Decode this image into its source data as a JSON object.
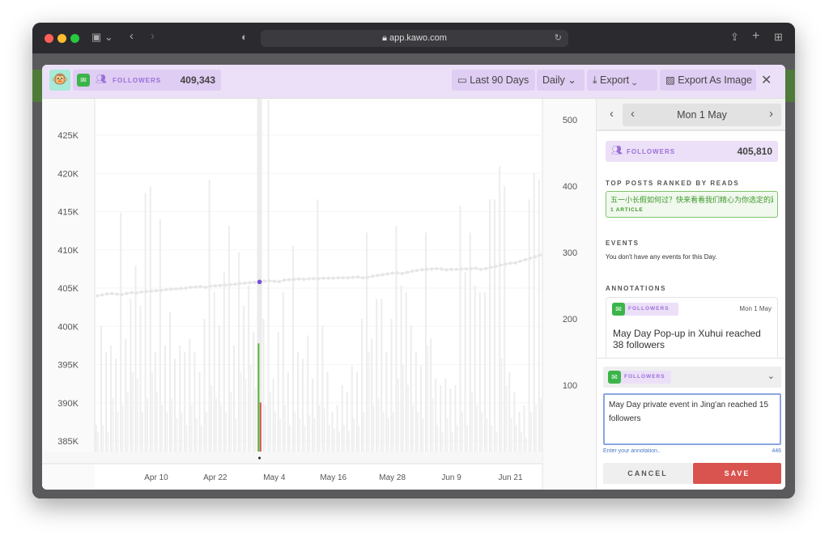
{
  "browser": {
    "url": "app.kawo.com"
  },
  "header": {
    "metric_label": "FOLLOWERS",
    "metric_value": "409,343",
    "range_label": "Last 90 Days",
    "interval_label": "Daily",
    "export_label": "Export",
    "export_image_label": "Export As Image"
  },
  "side": {
    "date": "Mon 1 May",
    "followers_label": "FOLLOWERS",
    "followers_value": "405,810",
    "top_posts_title": "TOP POSTS RANKED BY READS",
    "top_post_title": "五一小长假如何过？快来看看我们精心为你选定的路线",
    "top_post_count": "1 ARTICLE",
    "events_title": "EVENTS",
    "events_empty": "You don't have any events for this Day.",
    "annotations_title": "ANNOTATIONS",
    "annotation": {
      "metric": "FOLLOWERS",
      "date": "Mon 1 May",
      "text": "May Day Pop-up in Xuhui reached 38 followers"
    },
    "editor": {
      "metric": "FOLLOWERS",
      "value": "May Day private event in Jing'an reached 15 followers",
      "hint": "Enter your annotation..",
      "remaining": "446",
      "cancel": "CANCEL",
      "save": "SAVE"
    }
  },
  "colors": {
    "accent": "#9b6fd8",
    "green_bar": "#5bb33a",
    "red_bar": "#d9534f",
    "save": "#d9534f",
    "wechat": "#3bb54a"
  },
  "chart_data": {
    "type": "bar+line",
    "x_start": "2023-03-29",
    "x_end": "2023-06-27",
    "x_ticks": [
      "Apr 10",
      "Apr 22",
      "May 4",
      "May 16",
      "May 28",
      "Jun 9",
      "Jun 21"
    ],
    "x_tick_days": [
      12,
      24,
      36,
      48,
      60,
      72,
      84
    ],
    "left_axis": {
      "ticks": [
        "385K",
        "390K",
        "395K",
        "400K",
        "405K",
        "410K",
        "415K",
        "420K",
        "425K"
      ],
      "range": [
        381000,
        430000
      ]
    },
    "right_axis": {
      "ticks": [
        "100",
        "200",
        "300",
        "400",
        "500"
      ],
      "range": [
        0,
        530
      ]
    },
    "highlight_index": 33,
    "followers": [
      404000,
      404100,
      404250,
      404300,
      404200,
      404150,
      404300,
      404400,
      404350,
      404500,
      404550,
      404600,
      404650,
      404700,
      404800,
      404850,
      404900,
      404950,
      405000,
      405100,
      405150,
      405200,
      405100,
      405250,
      405300,
      405350,
      405400,
      405450,
      405500,
      405600,
      405650,
      405700,
      405750,
      405810,
      405900,
      405950,
      405900,
      405850,
      406050,
      406100,
      406150,
      406200,
      406150,
      406200,
      406250,
      406250,
      406300,
      406300,
      406300,
      406350,
      406350,
      406350,
      406400,
      406450,
      406350,
      406400,
      406550,
      406650,
      406750,
      406850,
      406950,
      407000,
      406900,
      407050,
      407200,
      407300,
      407400,
      407450,
      407500,
      407550,
      407500,
      407400,
      407450,
      407450,
      407500,
      407500,
      407550,
      407600,
      407450,
      407550,
      407700,
      407850,
      408000,
      408150,
      408250,
      408300,
      408500,
      408700,
      408900,
      409100,
      409343
    ],
    "series": [
      {
        "values": [
          40,
          190,
          150,
          160,
          140,
          360,
          170,
          230,
          280,
          220,
          390,
          400,
          150,
          350,
          160,
          210,
          140,
          160,
          150,
          170,
          150,
          120,
          200,
          410,
          240,
          190,
          270,
          340,
          160,
          300,
          220,
          250,
          180,
          163,
          200,
          530,
          110,
          180,
          240,
          120,
          310,
          150,
          140,
          175,
          110,
          380,
          190,
          120,
          60,
          70,
          100,
          90,
          130,
          120,
          200,
          330,
          170,
          230,
          230,
          150,
          200,
          340,
          250,
          240,
          190,
          150,
          130,
          330,
          170,
          110,
          100,
          110,
          95,
          100,
          370,
          270,
          330,
          250,
          240,
          240,
          380,
          380,
          430,
          400,
          120,
          90,
          60,
          70,
          380,
          420,
          410
        ]
      },
      {
        "values": [
          30,
          40,
          30,
          80,
          60,
          70,
          90,
          120,
          110,
          60,
          80,
          120,
          90,
          70,
          60,
          80,
          50,
          60,
          40,
          70,
          50,
          40,
          60,
          100,
          80,
          70,
          60,
          90,
          50,
          120,
          110,
          130,
          95,
          74,
          70,
          90,
          60,
          50,
          70,
          40,
          60,
          50,
          40,
          55,
          50,
          70,
          65,
          40,
          35,
          30,
          40,
          30,
          50,
          40,
          60,
          150,
          70,
          80,
          60,
          50,
          60,
          110,
          130,
          100,
          70,
          60,
          50,
          160,
          80,
          40,
          30,
          50,
          30,
          40,
          60,
          40,
          90,
          70,
          60,
          50,
          40,
          30,
          140,
          100,
          50,
          40,
          30,
          20,
          60,
          70,
          80
        ]
      }
    ]
  }
}
